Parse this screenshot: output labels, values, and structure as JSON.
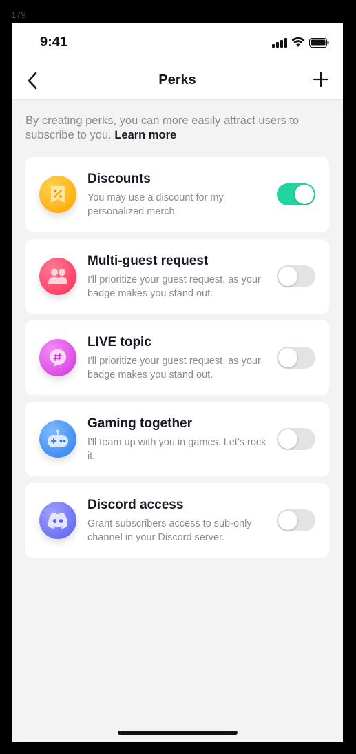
{
  "frame_label": "179",
  "status_bar": {
    "time": "9:41"
  },
  "nav": {
    "title": "Perks"
  },
  "intro": {
    "text": "By creating perks, you can more easily attract users to subscribe to you.",
    "link": "Learn more"
  },
  "perks": [
    {
      "title": "Discounts",
      "description": "You may use a discount for my personalized merch.",
      "enabled": true,
      "icon": "discount-tag-icon",
      "color": "#ffb400"
    },
    {
      "title": "Multi-guest request",
      "description": "I'll prioritize your guest request, as your badge makes you stand out.",
      "enabled": false,
      "icon": "people-icon",
      "color": "#fe3c6a"
    },
    {
      "title": "LIVE topic",
      "description": "I'll prioritize your guest request, as your badge makes you stand out.",
      "enabled": false,
      "icon": "hashtag-chat-icon",
      "color": "#e04ae9"
    },
    {
      "title": "Gaming together",
      "description": "I'll team up with you in games. Let's rock it.",
      "enabled": false,
      "icon": "game-controller-icon",
      "color": "#3d8ef5"
    },
    {
      "title": "Discord access",
      "description": "Grant subscribers access to sub-only channel in your Discord server.",
      "enabled": false,
      "icon": "discord-icon",
      "color": "#6b6ef0"
    }
  ],
  "colors": {
    "toggle_on": "#20d5a0",
    "toggle_off": "#e3e3e4",
    "background": "#f3f3f3"
  }
}
